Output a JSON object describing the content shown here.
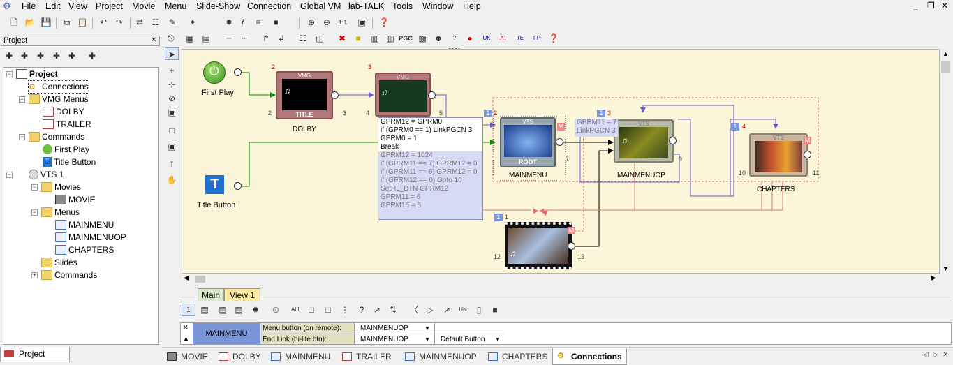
{
  "menubar": {
    "items": [
      "File",
      "Edit",
      "View",
      "Project",
      "Movie",
      "Menu",
      "Slide-Show",
      "Connection",
      "Global VM",
      "lab-TALK",
      "Tools",
      "Window",
      "Help"
    ],
    "window_controls": [
      "_",
      "❐",
      "✕"
    ]
  },
  "project_panel": {
    "title": "Project",
    "close": "✕",
    "tree": {
      "root": "Project",
      "connections": "Connections",
      "vmg_menus": "VMG Menus",
      "dolby": "DOLBY",
      "trailer": "TRAILER",
      "commands": "Commands",
      "first_play": "First Play",
      "title_button": "Title Button",
      "vts1": "VTS 1",
      "movies": "Movies",
      "movie": "MOVIE",
      "menus": "Menus",
      "mainmenu": "MAINMENU",
      "mainmenuop": "MAINMENUOP",
      "chapters": "CHAPTERS",
      "slides": "Slides",
      "commands2": "Commands"
    },
    "bottom_tab": "Project"
  },
  "canvas": {
    "first_play_label": "First Play",
    "title_button_label": "Title Button",
    "dolby": {
      "label": "DOLBY",
      "vmg": "VMG",
      "title": "TITLE",
      "num": "2",
      "in": "2",
      "out": "3"
    },
    "trailer": {
      "vmg": "VMG",
      "num": "3",
      "in": "4",
      "out": "5"
    },
    "mainmenu": {
      "label": "MAINMENU",
      "vts": "VTS",
      "root": "ROOT",
      "badge": "1",
      "num": "2",
      "out": "7",
      "m": "M"
    },
    "mainmenuop": {
      "label": "MAINMENUOP",
      "vts": "VTS",
      "badge": "1",
      "num": "3",
      "out": "9"
    },
    "chapters": {
      "label": "CHAPTERS",
      "vts": "VTS",
      "badge": "1",
      "num": "4",
      "in": "10",
      "out": "11",
      "m": "M"
    },
    "movie": {
      "badge": "1",
      "num": "1",
      "in": "12",
      "out": "13",
      "m": "M"
    },
    "script_lines": [
      {
        "text": "GPRM12 = GPRM0",
        "style": "black"
      },
      {
        "text": "if (GPRM0 == 1) LinkPGCN 3",
        "style": "black"
      },
      {
        "text": "GPRM0 = 1",
        "style": "black"
      },
      {
        "text": "Break",
        "style": "black"
      },
      {
        "text": "GPRM12 = 1024",
        "style": "grey"
      },
      {
        "text": "if (GPRM11 == 7) GPRM12 = 0",
        "style": "grey"
      },
      {
        "text": "if (GPRM11 == 6) GPRM12 = 0",
        "style": "grey"
      },
      {
        "text": "if (GPRM12 == 0) Goto 10",
        "style": "grey"
      },
      {
        "text": "SetHL_BTN GPRM12",
        "style": "grey"
      },
      {
        "text": "GPRM11 = 6",
        "style": "grey"
      },
      {
        "text": "GPRM15 = 6",
        "style": "grey"
      }
    ],
    "script2_lines": [
      "GPRM11 = 7",
      "LinkPGCN 3"
    ]
  },
  "bottom_tabs": [
    "Main",
    "View 1"
  ],
  "bottom_toolbar_first": "1",
  "prop_grid": {
    "close": "✕",
    "selected": "MAINMENU",
    "row1_label": "Menu button (on remote):",
    "row1_value": "MAINMENUOP",
    "row2_label": "End Link (hi-lite btn):",
    "row2_value": "MAINMENUOP",
    "row2_extra": "Default Button"
  },
  "doc_tabs": [
    "MOVIE",
    "DOLBY",
    "MAINMENU",
    "TRAILER",
    "MAINMENUOP",
    "CHAPTERS",
    "Connections"
  ],
  "doc_nav": [
    "◁",
    "▷",
    "✕"
  ],
  "colors": {
    "canvas_bg": "#fbf6d9",
    "accent_blue": "#7a96d8",
    "green": "#00a000",
    "purple": "#7060c0",
    "red_link": "#e07070"
  }
}
